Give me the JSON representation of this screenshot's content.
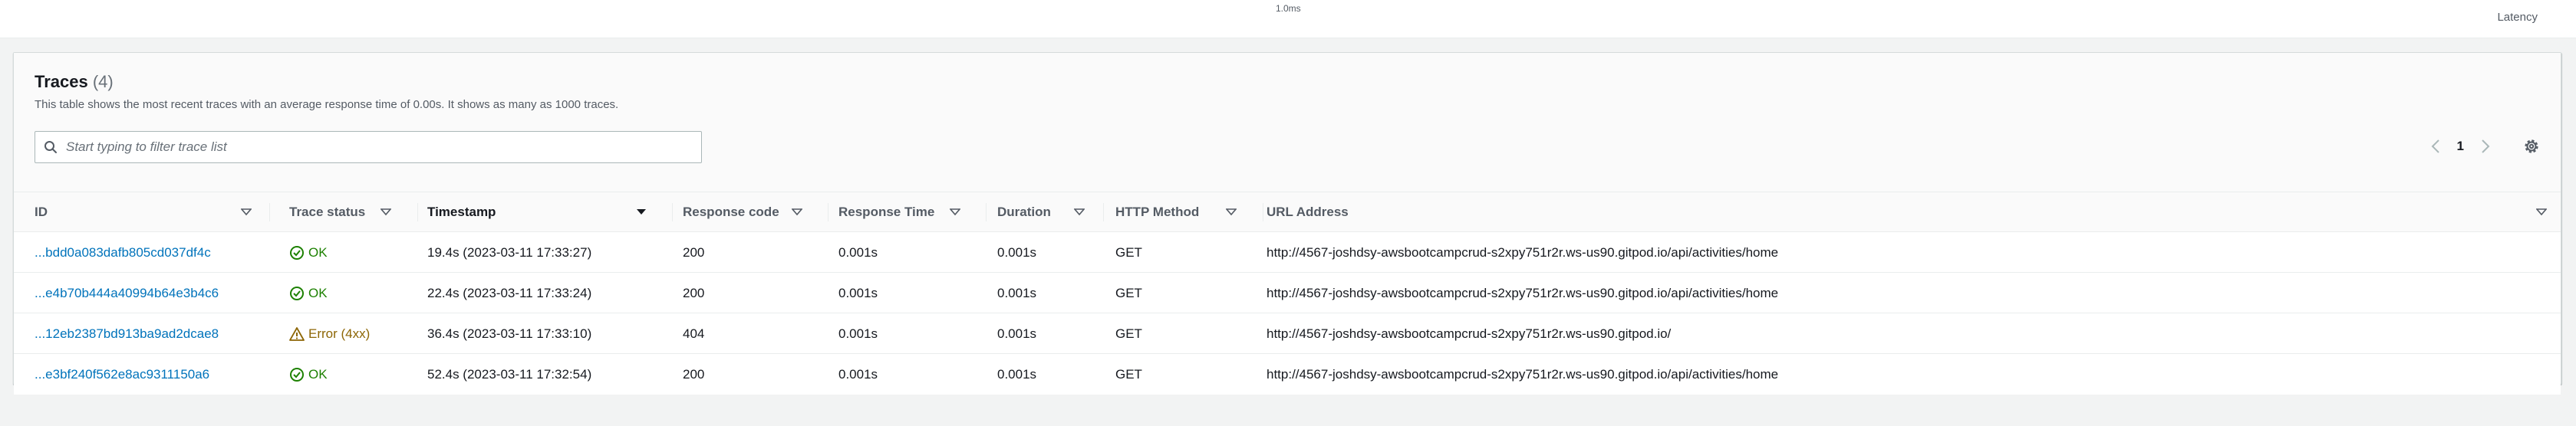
{
  "chart": {
    "tick_label": "1.0ms",
    "axis_label": "Latency"
  },
  "panel": {
    "title": "Traces",
    "count": "(4)",
    "description": "This table shows the most recent traces with an average response time of 0.00s. It shows as many as 1000 traces.",
    "search_placeholder": "Start typing to filter trace list",
    "search_value": "",
    "page_number": "1",
    "icons": {
      "search": "search-icon",
      "prev": "chevron-left-icon",
      "next": "chevron-right-icon",
      "settings": "gear-icon"
    }
  },
  "table": {
    "columns": [
      {
        "label": "ID",
        "sortable": true
      },
      {
        "label": "Trace status",
        "sortable": true
      },
      {
        "label": "Timestamp",
        "sortable": true,
        "sorted": "desc"
      },
      {
        "label": "Response code",
        "sortable": true
      },
      {
        "label": "Response Time",
        "sortable": true
      },
      {
        "label": "Duration",
        "sortable": true
      },
      {
        "label": "HTTP Method",
        "sortable": true
      },
      {
        "label": "URL Address",
        "sortable": true
      }
    ],
    "rows": [
      {
        "id": "...bdd0a083dafb805cd037df4c",
        "status": "OK",
        "status_kind": "ok",
        "timestamp": "19.4s (2023-03-11 17:33:27)",
        "response_code": "200",
        "response_time": "0.001s",
        "duration": "0.001s",
        "method": "GET",
        "url": "http://4567-joshdsy-awsbootcampcrud-s2xpy751r2r.ws-us90.gitpod.io/api/activities/home"
      },
      {
        "id": "...e4b70b444a40994b64e3b4c6",
        "status": "OK",
        "status_kind": "ok",
        "timestamp": "22.4s (2023-03-11 17:33:24)",
        "response_code": "200",
        "response_time": "0.001s",
        "duration": "0.001s",
        "method": "GET",
        "url": "http://4567-joshdsy-awsbootcampcrud-s2xpy751r2r.ws-us90.gitpod.io/api/activities/home"
      },
      {
        "id": "...12eb2387bd913ba9ad2dcae8",
        "status": "Error (4xx)",
        "status_kind": "error",
        "timestamp": "36.4s (2023-03-11 17:33:10)",
        "response_code": "404",
        "response_time": "0.001s",
        "duration": "0.001s",
        "method": "GET",
        "url": "http://4567-joshdsy-awsbootcampcrud-s2xpy751r2r.ws-us90.gitpod.io/"
      },
      {
        "id": "...e3bf240f562e8ac9311150a6",
        "status": "OK",
        "status_kind": "ok",
        "timestamp": "52.4s (2023-03-11 17:32:54)",
        "response_code": "200",
        "response_time": "0.001s",
        "duration": "0.001s",
        "method": "GET",
        "url": "http://4567-joshdsy-awsbootcampcrud-s2xpy751r2r.ws-us90.gitpod.io/api/activities/home"
      }
    ]
  },
  "colors": {
    "link": "#0073bb",
    "ok": "#1d8102",
    "error": "#8d6605",
    "text": "#16191f",
    "muted": "#545b64"
  }
}
